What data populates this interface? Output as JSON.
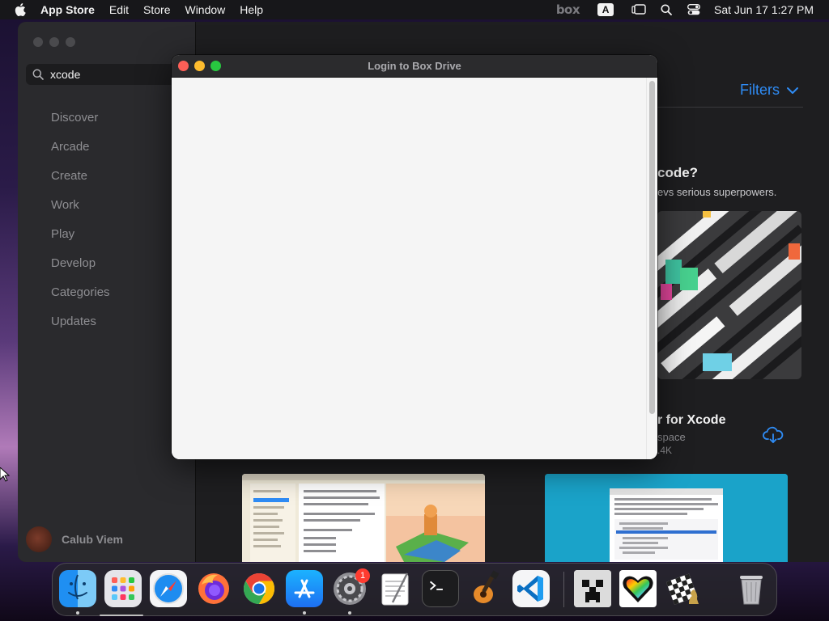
{
  "menubar": {
    "app_name": "App Store",
    "items": [
      "Edit",
      "Store",
      "Window",
      "Help"
    ],
    "box_logo": "box",
    "input_source": "A",
    "clock": "Sat Jun 17  1:27 PM"
  },
  "appstore": {
    "search_value": "xcode",
    "nav": [
      "Discover",
      "Arcade",
      "Create",
      "Work",
      "Play",
      "Develop",
      "Categories",
      "Updates"
    ],
    "user_name": "Calub Viem",
    "filters_label": "Filters",
    "promo_title": "code?",
    "promo_subtitle": "evs serious superpowers.",
    "app2_title": "r for Xcode",
    "app2_subtitle": "space",
    "app2_rating": ".4K"
  },
  "login_window": {
    "title": "Login to Box Drive"
  },
  "dock": {
    "apps": [
      "finder",
      "launchpad",
      "safari",
      "firefox",
      "chrome",
      "app-store",
      "system-settings",
      "textedit",
      "terminal",
      "garageband",
      "vscode",
      "minecraft",
      "pixel-heart",
      "chess",
      "trash"
    ],
    "settings_badge": "1"
  },
  "colors": {
    "accent": "#2f8cf5",
    "close": "#fe5f57",
    "minimize": "#febc2e",
    "maximize": "#28c840"
  }
}
